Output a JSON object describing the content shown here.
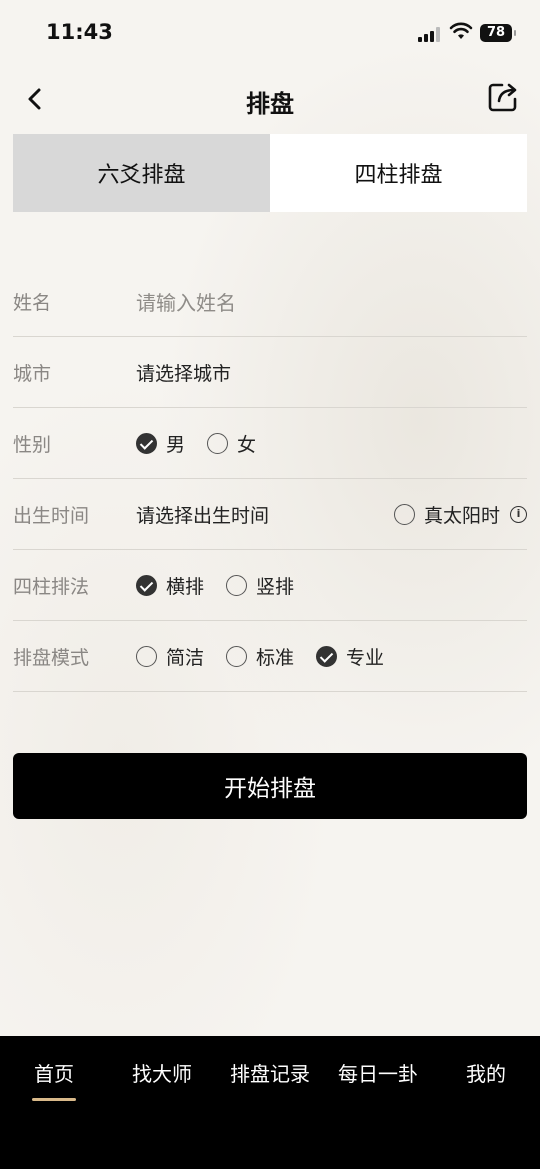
{
  "status_bar": {
    "time": "11:43",
    "battery": "78"
  },
  "header": {
    "title": "排盘"
  },
  "tabs": [
    {
      "label": "六爻排盘",
      "active": true
    },
    {
      "label": "四柱排盘",
      "active": false
    }
  ],
  "form": {
    "name": {
      "label": "姓名",
      "placeholder": "请输入姓名"
    },
    "city": {
      "label": "城市",
      "value": "请选择城市"
    },
    "gender": {
      "label": "性别",
      "options": [
        {
          "label": "男",
          "checked": true
        },
        {
          "label": "女",
          "checked": false
        }
      ]
    },
    "birth": {
      "label": "出生时间",
      "value": "请选择出生时间",
      "true_solar_label": "真太阳时",
      "true_solar_checked": false
    },
    "pillar_layout": {
      "label": "四柱排法",
      "options": [
        {
          "label": "横排",
          "checked": true
        },
        {
          "label": "竖排",
          "checked": false
        }
      ]
    },
    "mode": {
      "label": "排盘模式",
      "options": [
        {
          "label": "简洁",
          "checked": false
        },
        {
          "label": "标准",
          "checked": false
        },
        {
          "label": "专业",
          "checked": true
        }
      ]
    }
  },
  "start_button": "开始排盘",
  "bottom_nav": [
    {
      "label": "首页",
      "active": true
    },
    {
      "label": "找大师"
    },
    {
      "label": "排盘记录"
    },
    {
      "label": "每日一卦"
    },
    {
      "label": "我的"
    }
  ],
  "colors": {
    "accent": "#d9b98a",
    "tab_active_bg": "#d8d8d8",
    "button_bg": "#000000"
  }
}
